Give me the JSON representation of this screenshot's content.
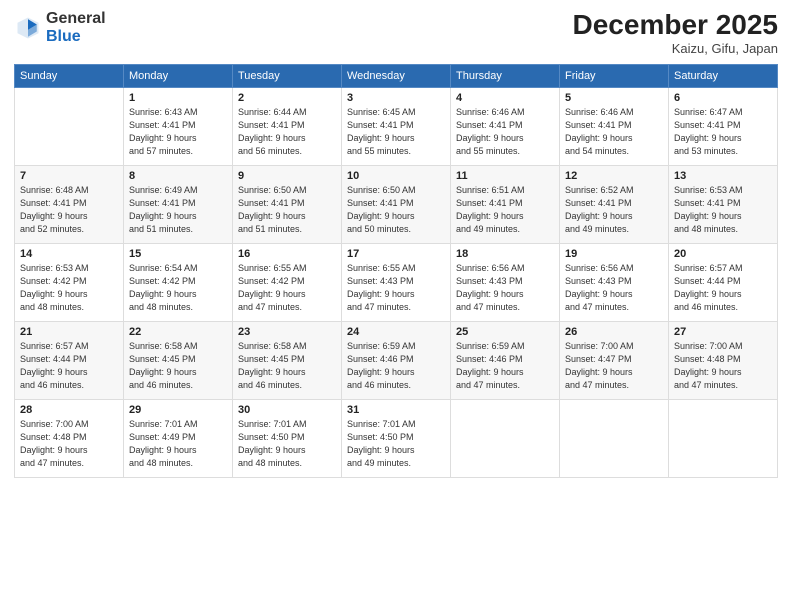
{
  "logo": {
    "general": "General",
    "blue": "Blue"
  },
  "header": {
    "month": "December 2025",
    "location": "Kaizu, Gifu, Japan"
  },
  "weekdays": [
    "Sunday",
    "Monday",
    "Tuesday",
    "Wednesday",
    "Thursday",
    "Friday",
    "Saturday"
  ],
  "weeks": [
    [
      {
        "day": "",
        "info": ""
      },
      {
        "day": "1",
        "info": "Sunrise: 6:43 AM\nSunset: 4:41 PM\nDaylight: 9 hours\nand 57 minutes."
      },
      {
        "day": "2",
        "info": "Sunrise: 6:44 AM\nSunset: 4:41 PM\nDaylight: 9 hours\nand 56 minutes."
      },
      {
        "day": "3",
        "info": "Sunrise: 6:45 AM\nSunset: 4:41 PM\nDaylight: 9 hours\nand 55 minutes."
      },
      {
        "day": "4",
        "info": "Sunrise: 6:46 AM\nSunset: 4:41 PM\nDaylight: 9 hours\nand 55 minutes."
      },
      {
        "day": "5",
        "info": "Sunrise: 6:46 AM\nSunset: 4:41 PM\nDaylight: 9 hours\nand 54 minutes."
      },
      {
        "day": "6",
        "info": "Sunrise: 6:47 AM\nSunset: 4:41 PM\nDaylight: 9 hours\nand 53 minutes."
      }
    ],
    [
      {
        "day": "7",
        "info": "Sunrise: 6:48 AM\nSunset: 4:41 PM\nDaylight: 9 hours\nand 52 minutes."
      },
      {
        "day": "8",
        "info": "Sunrise: 6:49 AM\nSunset: 4:41 PM\nDaylight: 9 hours\nand 51 minutes."
      },
      {
        "day": "9",
        "info": "Sunrise: 6:50 AM\nSunset: 4:41 PM\nDaylight: 9 hours\nand 51 minutes."
      },
      {
        "day": "10",
        "info": "Sunrise: 6:50 AM\nSunset: 4:41 PM\nDaylight: 9 hours\nand 50 minutes."
      },
      {
        "day": "11",
        "info": "Sunrise: 6:51 AM\nSunset: 4:41 PM\nDaylight: 9 hours\nand 49 minutes."
      },
      {
        "day": "12",
        "info": "Sunrise: 6:52 AM\nSunset: 4:41 PM\nDaylight: 9 hours\nand 49 minutes."
      },
      {
        "day": "13",
        "info": "Sunrise: 6:53 AM\nSunset: 4:41 PM\nDaylight: 9 hours\nand 48 minutes."
      }
    ],
    [
      {
        "day": "14",
        "info": "Sunrise: 6:53 AM\nSunset: 4:42 PM\nDaylight: 9 hours\nand 48 minutes."
      },
      {
        "day": "15",
        "info": "Sunrise: 6:54 AM\nSunset: 4:42 PM\nDaylight: 9 hours\nand 48 minutes."
      },
      {
        "day": "16",
        "info": "Sunrise: 6:55 AM\nSunset: 4:42 PM\nDaylight: 9 hours\nand 47 minutes."
      },
      {
        "day": "17",
        "info": "Sunrise: 6:55 AM\nSunset: 4:43 PM\nDaylight: 9 hours\nand 47 minutes."
      },
      {
        "day": "18",
        "info": "Sunrise: 6:56 AM\nSunset: 4:43 PM\nDaylight: 9 hours\nand 47 minutes."
      },
      {
        "day": "19",
        "info": "Sunrise: 6:56 AM\nSunset: 4:43 PM\nDaylight: 9 hours\nand 47 minutes."
      },
      {
        "day": "20",
        "info": "Sunrise: 6:57 AM\nSunset: 4:44 PM\nDaylight: 9 hours\nand 46 minutes."
      }
    ],
    [
      {
        "day": "21",
        "info": "Sunrise: 6:57 AM\nSunset: 4:44 PM\nDaylight: 9 hours\nand 46 minutes."
      },
      {
        "day": "22",
        "info": "Sunrise: 6:58 AM\nSunset: 4:45 PM\nDaylight: 9 hours\nand 46 minutes."
      },
      {
        "day": "23",
        "info": "Sunrise: 6:58 AM\nSunset: 4:45 PM\nDaylight: 9 hours\nand 46 minutes."
      },
      {
        "day": "24",
        "info": "Sunrise: 6:59 AM\nSunset: 4:46 PM\nDaylight: 9 hours\nand 46 minutes."
      },
      {
        "day": "25",
        "info": "Sunrise: 6:59 AM\nSunset: 4:46 PM\nDaylight: 9 hours\nand 47 minutes."
      },
      {
        "day": "26",
        "info": "Sunrise: 7:00 AM\nSunset: 4:47 PM\nDaylight: 9 hours\nand 47 minutes."
      },
      {
        "day": "27",
        "info": "Sunrise: 7:00 AM\nSunset: 4:48 PM\nDaylight: 9 hours\nand 47 minutes."
      }
    ],
    [
      {
        "day": "28",
        "info": "Sunrise: 7:00 AM\nSunset: 4:48 PM\nDaylight: 9 hours\nand 47 minutes."
      },
      {
        "day": "29",
        "info": "Sunrise: 7:01 AM\nSunset: 4:49 PM\nDaylight: 9 hours\nand 48 minutes."
      },
      {
        "day": "30",
        "info": "Sunrise: 7:01 AM\nSunset: 4:50 PM\nDaylight: 9 hours\nand 48 minutes."
      },
      {
        "day": "31",
        "info": "Sunrise: 7:01 AM\nSunset: 4:50 PM\nDaylight: 9 hours\nand 49 minutes."
      },
      {
        "day": "",
        "info": ""
      },
      {
        "day": "",
        "info": ""
      },
      {
        "day": "",
        "info": ""
      }
    ]
  ]
}
